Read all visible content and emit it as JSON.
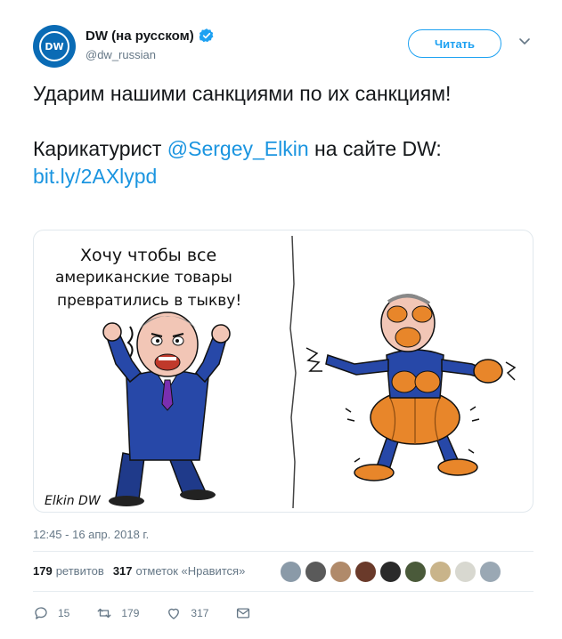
{
  "header": {
    "avatar_text": "DW",
    "display_name": "DW (на русском)",
    "handle": "@dw_russian",
    "follow_label": "Читать"
  },
  "tweet": {
    "line1": "Ударим нашими санкциями по их санкциям!",
    "line2_prefix": "Карикатурист ",
    "mention": "@Sergey_Elkin",
    "line2_suffix": " на сайте DW:",
    "link": "bit.ly/2AXlypd"
  },
  "cartoon": {
    "speech_line1": "Хочу чтобы все",
    "speech_line2": "американские товары",
    "speech_line3": "превратились в тыкву!",
    "signature": "Elkin DW"
  },
  "timestamp": "12:45 - 16 апр. 2018 г.",
  "stats": {
    "retweets_count": "179",
    "retweets_label": "ретвитов",
    "likes_count": "317",
    "likes_label": "отметок «Нравится»"
  },
  "actions": {
    "reply_count": "15",
    "retweet_count": "179",
    "like_count": "317"
  },
  "colors": {
    "accent": "#1da1f2",
    "link": "#1b95e0",
    "dw_blue": "#0a6bb5",
    "pumpkin": "#e8862a"
  }
}
